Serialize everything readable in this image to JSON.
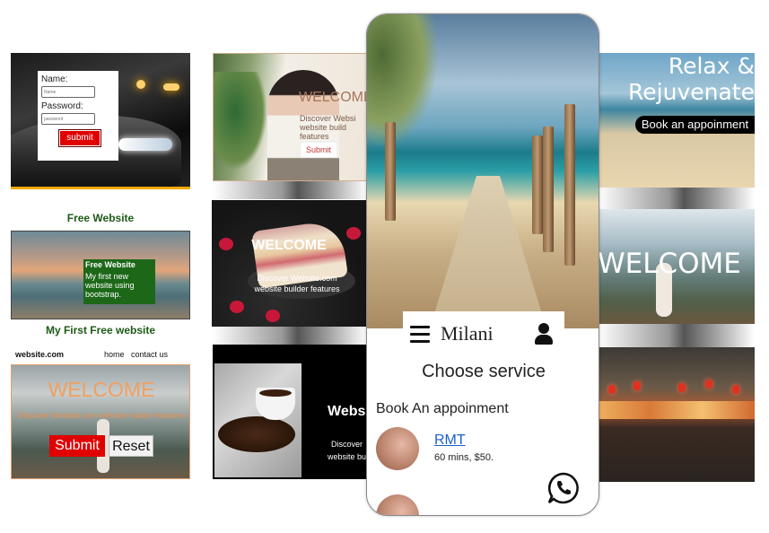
{
  "login_card": {
    "name_label": "Name:",
    "name_placeholder": "Name",
    "password_label": "Password:",
    "password_placeholder": "password",
    "submit": "submit"
  },
  "welcome_card_1": {
    "title": "WELCOME",
    "subtitle": "Discover Websi website build features",
    "button": "Submit"
  },
  "free_website_heading": "Free Website",
  "beach_card": {
    "box_title": "Free Website",
    "box_text": "My first new website using bootstrap."
  },
  "my_first_heading": "My First Free website",
  "nav": {
    "brand": "website.com",
    "links": [
      "home",
      "contact us"
    ]
  },
  "yoga_card": {
    "title": "WELCOME",
    "subtitle": "Discover Website.com website builder features",
    "submit": "Submit",
    "reset": "Reset"
  },
  "cake_card": {
    "title": "WELCOME",
    "subtitle": "Discover Website.com website builder features"
  },
  "coffee_card": {
    "title": "Webs",
    "line1": "Discover",
    "line2": "website bu"
  },
  "relax_card": {
    "title_line1": "Relax &",
    "title_line2": "Rejuvenate",
    "button": "Book an appoinment"
  },
  "welcome_card_2": {
    "title": "WELCOME"
  },
  "phone": {
    "brand": "Milani",
    "heading": "Choose service",
    "section": "Book An appoinment",
    "service_name": "RMT",
    "service_detail": "60 mins, $50."
  },
  "colors": {
    "accent_red": "#e00000",
    "green": "#1d5a16",
    "link_blue": "#1a5fd0",
    "orange": "#f0a060"
  },
  "icons": [
    "menu-icon",
    "user-icon",
    "whatsapp-icon"
  ]
}
